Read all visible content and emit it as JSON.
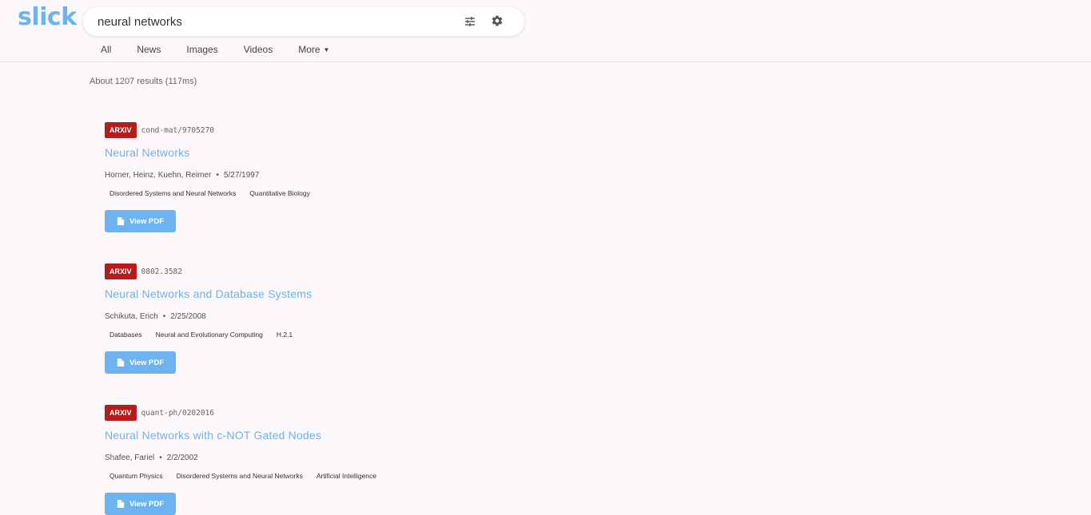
{
  "app": {
    "logo": "slick"
  },
  "search": {
    "query": "neural networks"
  },
  "tabs": [
    "All",
    "News",
    "Images",
    "Videos",
    "More"
  ],
  "results_info": "About 1207 results (117ms)",
  "results": [
    {
      "source": "ARXIV",
      "id": "cond-mat/9705270",
      "title": "Neural Networks",
      "authors": "Horner, Heinz, Kuehn, Reimer",
      "date": "5/27/1997",
      "tags": [
        "Disordered Systems and Neural Networks",
        "Quantitative Biology"
      ],
      "button": "View PDF"
    },
    {
      "source": "ARXIV",
      "id": "0802.3582",
      "title": "Neural Networks and Database Systems",
      "authors": "Schikuta, Erich",
      "date": "2/25/2008",
      "tags": [
        "Databases",
        "Neural and Evolutionary Computing",
        "H.2.1"
      ],
      "button": "View PDF"
    },
    {
      "source": "ARXIV",
      "id": "quant-ph/0202016",
      "title": "Neural Networks with c-NOT Gated Nodes",
      "authors": "Shafee, Fariel",
      "date": "2/2/2002",
      "tags": [
        "Quantum Physics",
        "Disordered Systems and Neural Networks",
        "Artificial Intelligence"
      ],
      "button": "View PDF"
    }
  ],
  "colors": {
    "accent": "#6db3f2",
    "badge": "#b71c1c",
    "background": "#fbf7fb"
  }
}
